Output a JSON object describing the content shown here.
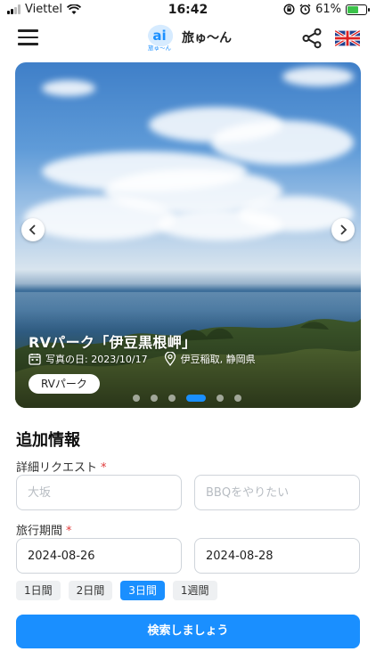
{
  "status_bar": {
    "carrier": "Viettel",
    "time": "16:42",
    "battery": "61%",
    "battery_level": 0.61
  },
  "header": {
    "brand": "旅ゅ〜ん",
    "logo_letter": "ai",
    "logo_sub": "旅ゅ〜ん"
  },
  "hero": {
    "title": "RVパーク「伊豆黒根岬」",
    "photo_date": "写真の日: 2023/10/17",
    "location": "伊豆稲取, 静岡県",
    "tag": "RVパーク",
    "slide_count": 6,
    "active_slide": 3
  },
  "form": {
    "section_title": "追加情報",
    "request_label": "詳細リクエスト",
    "required_mark": "*",
    "request_placeholder_1": "大坂",
    "request_placeholder_2": "BBQをやりたい",
    "period_label": "旅行期間",
    "start_date": "2024-08-26",
    "end_date": "2024-08-28",
    "durations": [
      {
        "label": "1日間",
        "active": false
      },
      {
        "label": "2日間",
        "active": false
      },
      {
        "label": "3日間",
        "active": true
      },
      {
        "label": "1週間",
        "active": false
      }
    ],
    "search_button": "検索しましょう"
  },
  "colors": {
    "accent": "#1a8fff",
    "required": "#e03a3a"
  }
}
